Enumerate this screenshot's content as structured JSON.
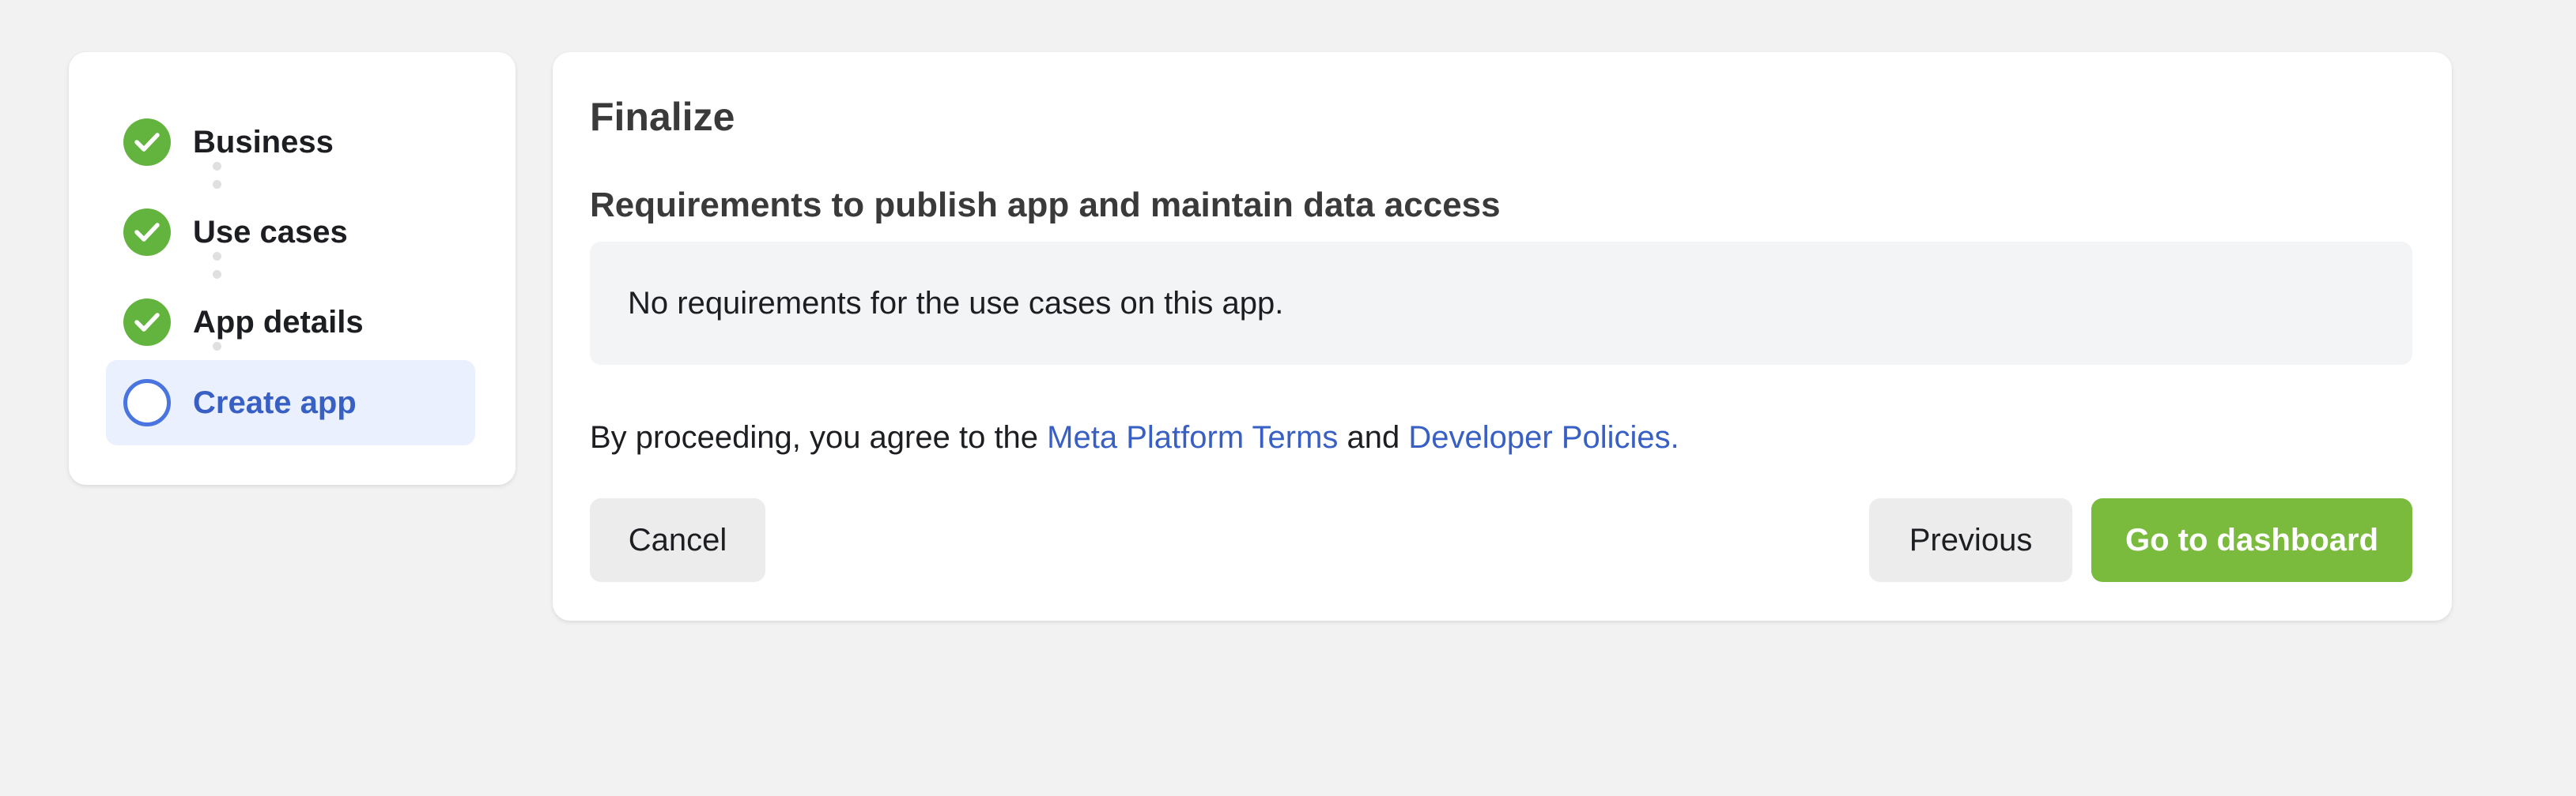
{
  "stepper": {
    "steps": [
      {
        "label": "Business",
        "status": "done",
        "icon": "check-circle-icon"
      },
      {
        "label": "Use cases",
        "status": "done",
        "icon": "check-circle-icon"
      },
      {
        "label": "App details",
        "status": "done",
        "icon": "check-circle-icon"
      },
      {
        "label": "Create app",
        "status": "current",
        "icon": "empty-circle-icon"
      }
    ]
  },
  "main": {
    "title": "Finalize",
    "requirements_heading": "Requirements to publish app and maintain data access",
    "requirements_message": "No requirements for the use cases on this app.",
    "terms": {
      "prefix": "By proceeding, you agree to the ",
      "link1": "Meta Platform Terms",
      "middle": " and ",
      "link2": "Developer Policies."
    },
    "buttons": {
      "cancel": "Cancel",
      "previous": "Previous",
      "dashboard": "Go to dashboard"
    }
  },
  "colors": {
    "background": "#f2f2f2",
    "success_green": "#63b33f",
    "primary_button": "#7abb3e",
    "link_blue": "#385fc4",
    "active_step_bg": "#eaf0fd",
    "current_ring": "#4a74e0"
  }
}
